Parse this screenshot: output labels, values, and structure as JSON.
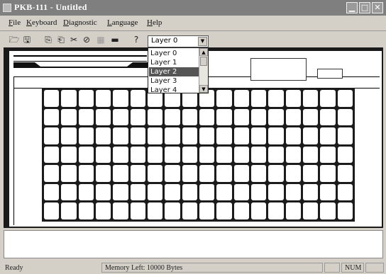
{
  "window": {
    "title": "PKB-111 - Untitled",
    "minimize_glyph": "▁",
    "maximize_glyph": "□",
    "close_glyph": "✕"
  },
  "menu": {
    "items": [
      {
        "underline": "F",
        "rest": "ile"
      },
      {
        "underline": "K",
        "rest": "eyboard"
      },
      {
        "underline": "D",
        "rest": "iagnostic"
      },
      {
        "underline": "L",
        "rest": "anguage"
      },
      {
        "underline": "H",
        "rest": "elp"
      }
    ]
  },
  "toolbar": {
    "icons": [
      "open-icon",
      "save-icon",
      "copy-layer-icon",
      "paste-layer-icon",
      "cut-icon",
      "link-icon",
      "delete-icon",
      "key-icon",
      "help-icon"
    ],
    "glyphs": [
      "🗁",
      "🖫",
      "⎘",
      "⎗",
      "✂",
      "⊘",
      "▦",
      "▬",
      "?"
    ],
    "layer_value": "Layer 0",
    "dropdown_arrow": "▼"
  },
  "layer_dropdown": {
    "options": [
      "Layer 0",
      "Layer 1",
      "Layer 2",
      "Layer 3",
      "Layer 4"
    ],
    "selected_index": 2,
    "scroll_up": "▲",
    "scroll_down": "▼"
  },
  "keyboard": {
    "columns": 18,
    "rows": 7
  },
  "status": {
    "ready": "Ready",
    "memory": "Memory Left: 10000 Bytes",
    "num": "NUM"
  }
}
